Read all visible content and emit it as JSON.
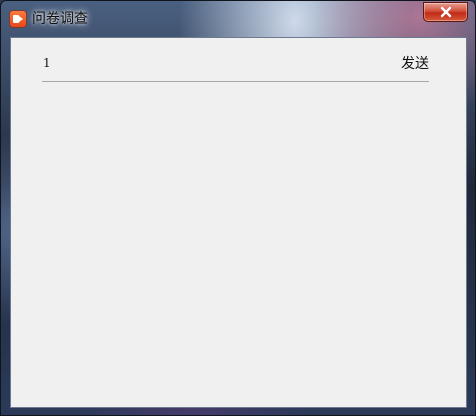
{
  "window": {
    "title": "问卷调查",
    "icon": "video-camera-app-icon",
    "close_icon": "close-icon"
  },
  "form": {
    "row_value": "1",
    "send_label": "发送"
  },
  "colors": {
    "client_bg": "#f0f0f0",
    "close_button": "#c02a18",
    "app_icon": "#e8461c",
    "divider": "#a8a8a8"
  }
}
